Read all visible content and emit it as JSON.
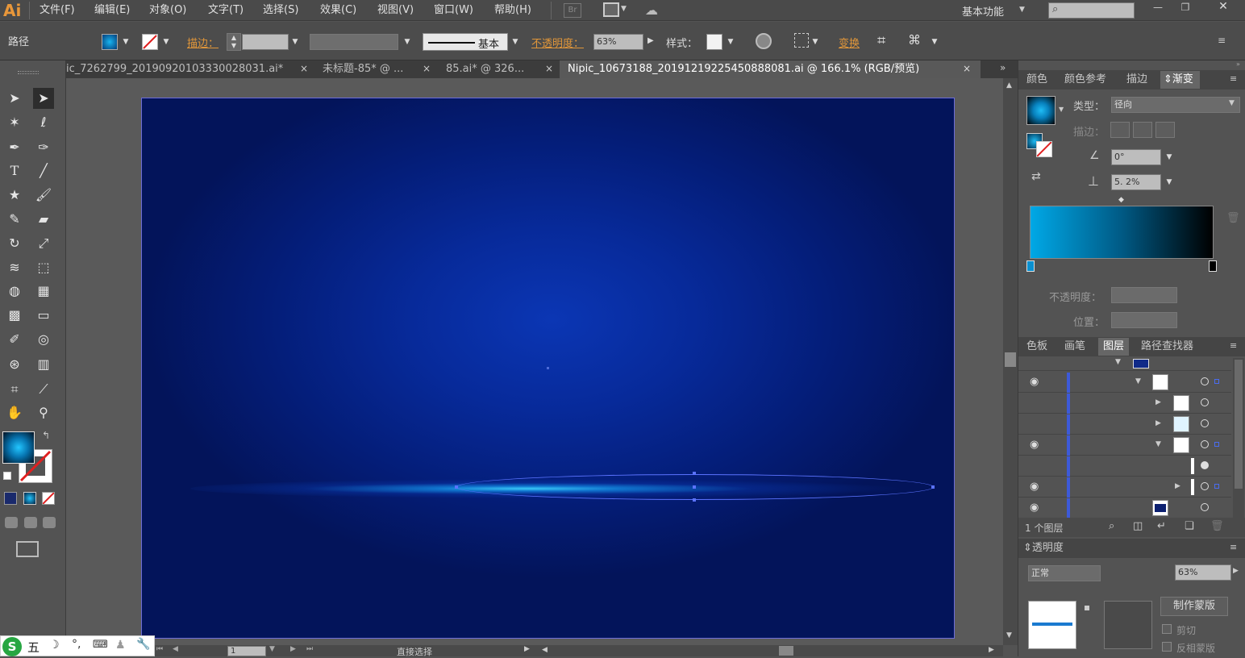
{
  "app": {
    "logo": "Ai"
  },
  "menu": {
    "items": [
      "文件(F)",
      "编辑(E)",
      "对象(O)",
      "文字(T)",
      "选择(S)",
      "效果(C)",
      "视图(V)",
      "窗口(W)",
      "帮助(H)"
    ],
    "bridge_label": "Br",
    "workspace": "基本功能",
    "search_placeholder": ""
  },
  "control": {
    "selection_type": "路径",
    "stroke_label": "描边：",
    "stroke_profile": "基本",
    "opacity_label": "不透明度：",
    "opacity_value": "63%",
    "style_label": "样式：",
    "transform_label": "变换"
  },
  "tabs": [
    {
      "label": "ic_7262799_20190920103330028031.ai*",
      "active": false
    },
    {
      "label": "未标题-85* @ ...",
      "active": false
    },
    {
      "label": "85.ai* @ 326...",
      "active": false
    },
    {
      "label": "Nipic_10673188_20191219225450888081.ai @ 166.1% (RGB/预览)",
      "active": true
    }
  ],
  "gradient_panel": {
    "tabs": [
      "颜色",
      "颜色参考",
      "描边",
      "渐变"
    ],
    "active_tab": "渐变",
    "type_label": "类型：",
    "type_value": "径向",
    "stroke_label": "描边：",
    "angle_value": "0°",
    "aspect_value": "5. 2%",
    "opacity_label": "不透明度：",
    "position_label": "位置：",
    "start_color": "#00a8e6",
    "end_color": "#000000"
  },
  "layers_panel": {
    "tabs": [
      "色板",
      "画笔",
      "图层",
      "路径查找器"
    ],
    "active_tab": "图层",
    "footer_count": "1 个图层"
  },
  "transparency_panel": {
    "title": "透明度",
    "mode": "正常",
    "opacity_value": "63%",
    "make_mask_label": "制作蒙版",
    "clip_label": "剪切",
    "invert_label": "反相蒙版"
  },
  "status": {
    "page": "1",
    "tool_name": "直接选择"
  },
  "ime": {
    "label": "五"
  },
  "colors": {
    "accent_orange": "#e0963a",
    "artboard_center": "#0b36b4",
    "artboard_edge": "#03145a",
    "glow": "#1fb8ff"
  }
}
